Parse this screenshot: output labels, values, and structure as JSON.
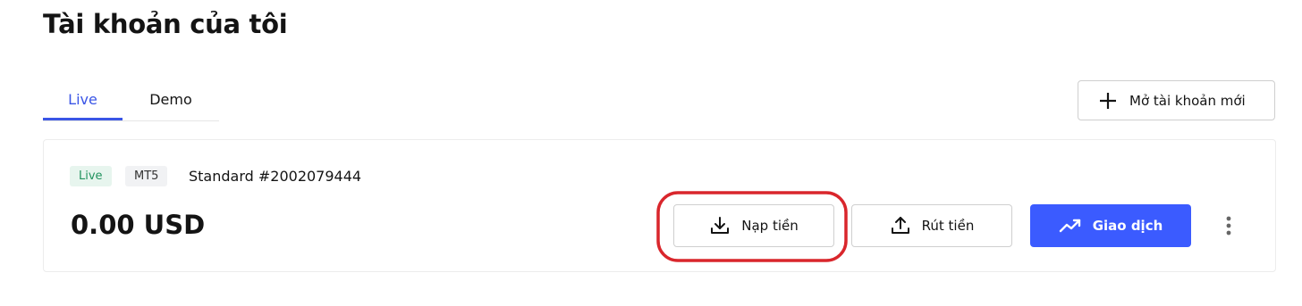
{
  "page": {
    "title": "Tài khoản của tôi"
  },
  "tabs": [
    {
      "label": "Live",
      "active": true
    },
    {
      "label": "Demo",
      "active": false
    }
  ],
  "open_account_button": {
    "label": "Mở tài khoản mới",
    "icon": "plus-icon"
  },
  "account": {
    "status_badge": "Live",
    "platform_badge": "MT5",
    "name": "Standard #2002079444",
    "balance": "0.00 USD"
  },
  "actions": {
    "deposit": {
      "label": "Nạp tiền",
      "icon": "download-icon"
    },
    "withdraw": {
      "label": "Rút tiền",
      "icon": "upload-icon"
    },
    "trade": {
      "label": "Giao dịch",
      "icon": "trending-up-icon"
    },
    "more": {
      "icon": "more-vertical-icon"
    }
  },
  "colors": {
    "accent": "#3b5bff",
    "tab_active": "#3a55e6",
    "live_badge_bg": "#e7f5ee",
    "live_badge_text": "#22935f",
    "highlight": "#d9262c"
  }
}
